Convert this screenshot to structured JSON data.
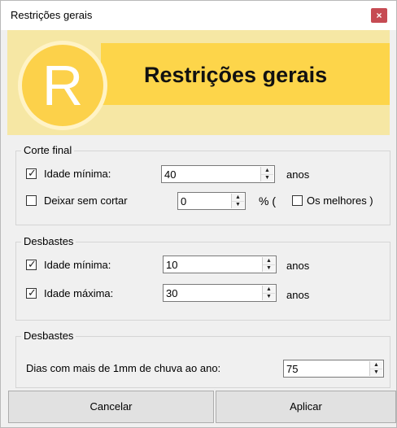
{
  "window": {
    "title": "Restrições gerais",
    "close_glyph": "×"
  },
  "banner": {
    "logo_letter": "R",
    "heading": "Restrições gerais"
  },
  "corte_final": {
    "label": "Corte final",
    "idade_minima": {
      "checked": true,
      "label": "Idade mínima:",
      "value": "40",
      "unit": "anos"
    },
    "deixar_sem_cortar": {
      "checked": false,
      "label": "Deixar sem cortar",
      "value": "0",
      "unit_prefix": "% (",
      "melhores_label": "Os melhores )",
      "melhores_checked": false
    }
  },
  "desbastes_1": {
    "label": "Desbastes",
    "idade_minima": {
      "checked": true,
      "label": "Idade mínima:",
      "value": "10",
      "unit": "anos"
    },
    "idade_maxima": {
      "checked": true,
      "label": "Idade máxima:",
      "value": "30",
      "unit": "anos"
    }
  },
  "desbastes_2": {
    "label": "Desbastes",
    "dias_chuva": {
      "label": "Dias com mais de 1mm de chuva ao ano:",
      "value": "75"
    }
  },
  "buttons": {
    "cancel": "Cancelar",
    "apply": "Aplicar"
  },
  "colors": {
    "banner_yellow": "#fdd54a",
    "banner_light": "#f6e7a4",
    "close_red": "#c64b53"
  }
}
